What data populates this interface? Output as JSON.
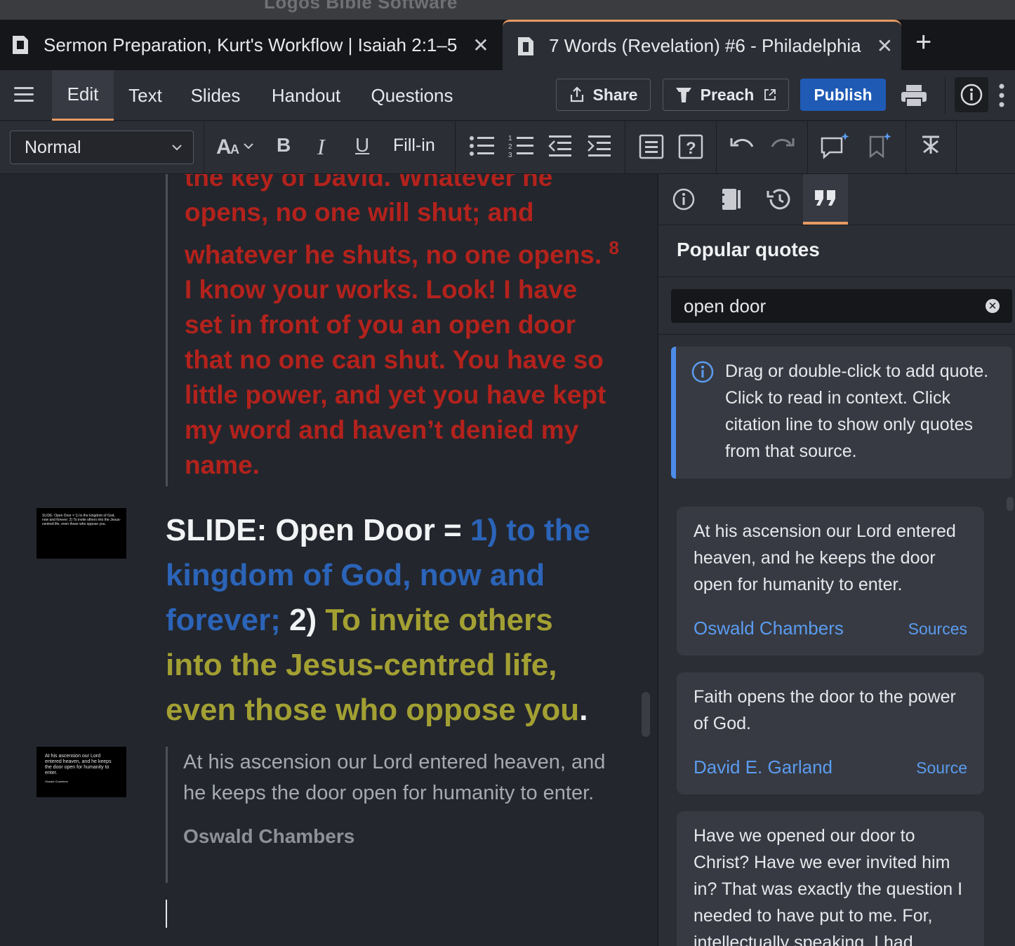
{
  "app": {
    "title": "Logos Bible Software"
  },
  "tabs": [
    {
      "label": "Sermon Preparation, Kurt's Workflow | Isaiah 2:1–5",
      "close": "✕"
    },
    {
      "label": "7 Words (Revelation) #6 - Philadelphia",
      "close": "✕"
    }
  ],
  "tab_add": "+",
  "menu": {
    "items": [
      "Edit",
      "Text",
      "Slides",
      "Handout",
      "Questions"
    ],
    "share": "Share",
    "preach": "Preach",
    "publish": "Publish"
  },
  "format": {
    "style_value": "Normal",
    "bold": "B",
    "italic": "I",
    "underline": "U",
    "fill_in": "Fill-in"
  },
  "editor": {
    "scripture_before": "the key of David. Whatever he opens, no one will shut; and whatever he shuts, no one opens.",
    "verse_num": "8",
    "scripture_after": "I know your works. Look! I have set in front of you an open door that no one can shut. You have so little power, and yet you have kept my word and haven’t denied my name.",
    "slide1_thumb": "SLIDE: Open Door = 1) to the kingdom of God, now and forever; 2) To invite others into the Jesus-centred life, even those who oppose you.",
    "heading": {
      "prefix": "SLIDE: Open Door = ",
      "part1": "1) to the kingdom of God, now and forever;",
      "num2": " 2) ",
      "part2": "To invite others into the Jesus-centred life, even those who oppose you",
      "end": "."
    },
    "slide2_thumb": "At his ascension our Lord entered heaven, and he keeps the door open for humanity to enter.",
    "slide2_thumb_author": "Oswald Chambers",
    "quote_text": "At his ascension our Lord entered heaven, and he keeps the door open for humanity to enter.",
    "quote_author": "Oswald Chambers"
  },
  "panel": {
    "title": "Popular quotes",
    "search_value": "open door",
    "info": "Drag or double-click to add quote. Click to read in context. Click citation line to show only quotes from that source.",
    "quotes": [
      {
        "text": "At his ascension our Lord entered heaven, and he keeps the door open for humanity to enter.",
        "author": "Oswald Chambers",
        "source": "Sources"
      },
      {
        "text": "Faith opens the door to the power of God.",
        "author": "David E. Garland",
        "source": "Source"
      },
      {
        "text": "Have we opened our door to Christ? Have we ever invited him in? That was exactly the question I needed to have put to me. For, intellectually speaking, I had",
        "author": "",
        "source": ""
      }
    ]
  },
  "colors": {
    "accent": "#e89a63",
    "publish": "#1f5bb5",
    "scripture_red": "#b3221c",
    "slide_blue": "#2b64b8",
    "slide_olive": "#a3a033",
    "link": "#5b9cf0"
  }
}
